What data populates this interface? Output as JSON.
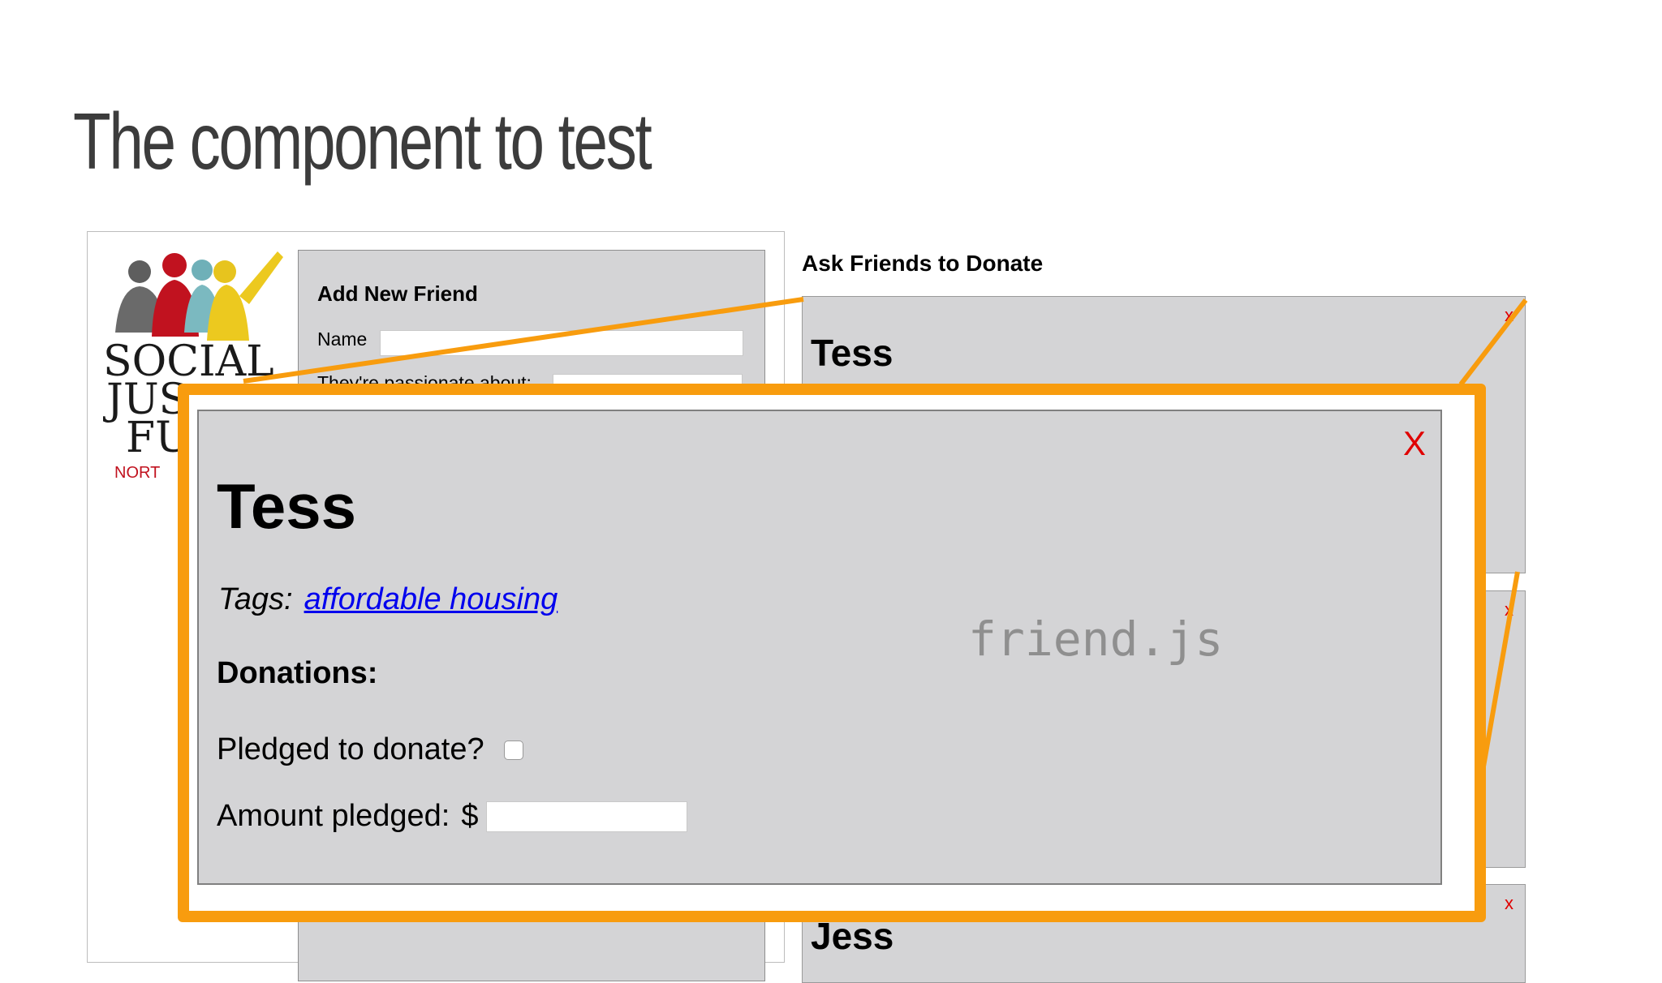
{
  "slide": {
    "title": "The component to test"
  },
  "logo": {
    "text_line1": "SOCIAL",
    "text_line2": "JUS",
    "text_line3": "FU",
    "text_line4": "NORT"
  },
  "add_friend_panel": {
    "title": "Add New Friend",
    "name_label": "Name",
    "passion_label": "They're passionate about:"
  },
  "ask_section": {
    "heading": "Ask Friends to Donate",
    "cards": [
      {
        "name": "Tess",
        "close": "x"
      },
      {
        "name": "",
        "close": "x"
      },
      {
        "name": "Jess",
        "close": "x"
      }
    ]
  },
  "callout": {
    "file_label": "friend.js",
    "friend": {
      "close": "X",
      "name": "Tess",
      "tags_label": "Tags:",
      "tag": "affordable housing",
      "donations_heading": "Donations:",
      "pledged_label": "Pledged to donate?",
      "pledged_checked": false,
      "amount_label": "Amount pledged:",
      "currency": "$",
      "amount_value": ""
    }
  },
  "colors": {
    "accent_orange": "#f89c0e",
    "card_gray": "#d4d4d6",
    "close_red": "#e00000",
    "link_blue": "#0000ee",
    "title_gray": "#3c3c3c"
  }
}
